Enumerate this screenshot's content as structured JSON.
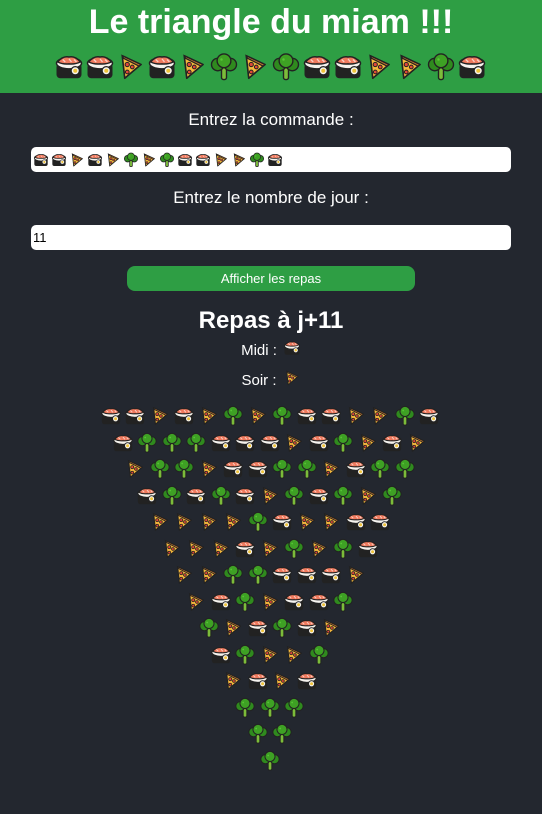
{
  "header": {
    "title": "Le triangle du miam !!!"
  },
  "header_icons": [
    "sushi-icon",
    "sushi-icon",
    "pizza-icon",
    "sushi-icon",
    "pizza-icon",
    "broccoli-icon",
    "pizza-icon",
    "broccoli-icon",
    "sushi-icon",
    "sushi-icon",
    "pizza-icon",
    "pizza-icon",
    "broccoli-icon",
    "sushi-icon"
  ],
  "form": {
    "command_label": "Entrez la commande :",
    "command_value_icons": [
      "sushi-icon",
      "sushi-icon",
      "pizza-icon",
      "sushi-icon",
      "pizza-icon",
      "broccoli-icon",
      "pizza-icon",
      "broccoli-icon",
      "sushi-icon",
      "sushi-icon",
      "pizza-icon",
      "pizza-icon",
      "broccoli-icon",
      "sushi-icon"
    ],
    "days_label": "Entrez le nombre de jour :",
    "days_value": "11",
    "submit_label": "Afficher les repas"
  },
  "result": {
    "title": "Repas à j+11",
    "midi_label": "Midi :",
    "midi_icon": "sushi-icon",
    "soir_label": "Soir :",
    "soir_icon": "pizza-icon"
  },
  "triangle": [
    [
      "sushi-icon",
      "sushi-icon",
      "pizza-icon",
      "sushi-icon",
      "pizza-icon",
      "broccoli-icon",
      "pizza-icon",
      "broccoli-icon",
      "sushi-icon",
      "sushi-icon",
      "pizza-icon",
      "pizza-icon",
      "broccoli-icon",
      "sushi-icon"
    ],
    [
      "sushi-icon",
      "broccoli-icon",
      "broccoli-icon",
      "broccoli-icon",
      "sushi-icon",
      "sushi-icon",
      "sushi-icon",
      "pizza-icon",
      "sushi-icon",
      "broccoli-icon",
      "pizza-icon",
      "sushi-icon",
      "pizza-icon"
    ],
    [
      "pizza-icon",
      "broccoli-icon",
      "broccoli-icon",
      "pizza-icon",
      "sushi-icon",
      "sushi-icon",
      "broccoli-icon",
      "broccoli-icon",
      "pizza-icon",
      "sushi-icon",
      "broccoli-icon",
      "broccoli-icon"
    ],
    [
      "sushi-icon",
      "broccoli-icon",
      "sushi-icon",
      "broccoli-icon",
      "sushi-icon",
      "pizza-icon",
      "broccoli-icon",
      "sushi-icon",
      "broccoli-icon",
      "pizza-icon",
      "broccoli-icon"
    ],
    [
      "pizza-icon",
      "pizza-icon",
      "pizza-icon",
      "pizza-icon",
      "broccoli-icon",
      "sushi-icon",
      "pizza-icon",
      "pizza-icon",
      "sushi-icon",
      "sushi-icon"
    ],
    [
      "pizza-icon",
      "pizza-icon",
      "pizza-icon",
      "sushi-icon",
      "pizza-icon",
      "broccoli-icon",
      "pizza-icon",
      "broccoli-icon",
      "sushi-icon"
    ],
    [
      "pizza-icon",
      "pizza-icon",
      "broccoli-icon",
      "broccoli-icon",
      "sushi-icon",
      "sushi-icon",
      "sushi-icon",
      "pizza-icon"
    ],
    [
      "pizza-icon",
      "sushi-icon",
      "broccoli-icon",
      "pizza-icon",
      "sushi-icon",
      "sushi-icon",
      "broccoli-icon"
    ],
    [
      "broccoli-icon",
      "pizza-icon",
      "sushi-icon",
      "broccoli-icon",
      "sushi-icon",
      "pizza-icon"
    ],
    [
      "sushi-icon",
      "broccoli-icon",
      "pizza-icon",
      "pizza-icon",
      "broccoli-icon"
    ],
    [
      "pizza-icon",
      "sushi-icon",
      "pizza-icon",
      "sushi-icon"
    ],
    [
      "broccoli-icon",
      "broccoli-icon",
      "broccoli-icon"
    ],
    [
      "broccoli-icon",
      "broccoli-icon"
    ],
    [
      "broccoli-icon"
    ]
  ],
  "colors": {
    "header_bg": "#2e9e44",
    "page_bg": "#23272f",
    "button_bg": "#2e9e44"
  }
}
